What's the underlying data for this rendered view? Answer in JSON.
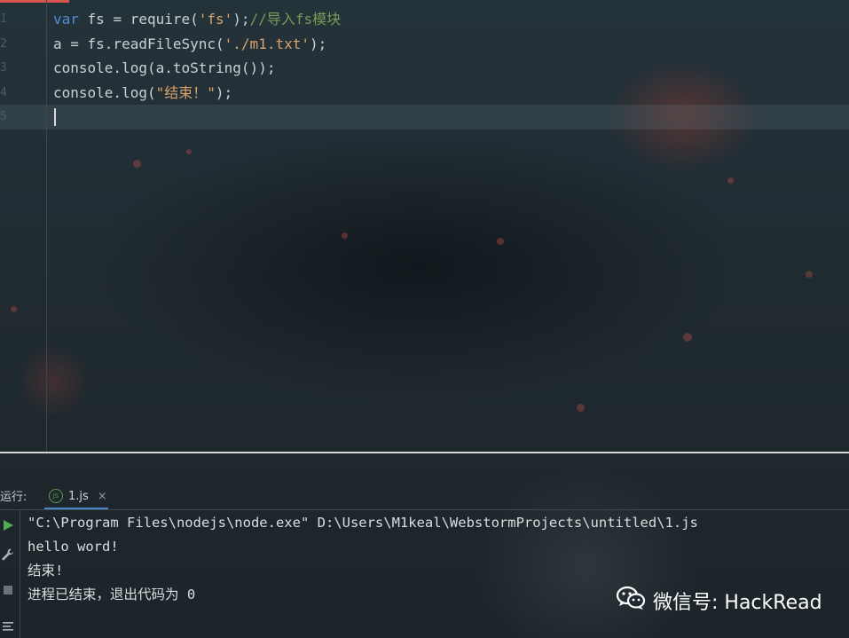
{
  "editor": {
    "line_numbers": [
      "1",
      "2",
      "3",
      "4",
      "5"
    ],
    "lines": [
      {
        "kw": "var",
        "plain": " fs = require(",
        "str": "'fs'",
        "tail": ");",
        "comment": "//导入fs模块"
      },
      {
        "plain": "a = fs.readFileSync(",
        "str": "'./m1.txt'",
        "tail": ");"
      },
      {
        "plain": "console.log(a.toString());"
      },
      {
        "plain": "console.log(",
        "str": "\"结束！\"",
        "tail": ");"
      }
    ]
  },
  "run_panel": {
    "label": "运行:",
    "tab_name": "1.js",
    "tab_icon": "JS",
    "tab_close": "×",
    "output": [
      "\"C:\\Program Files\\nodejs\\node.exe\" D:\\Users\\M1keal\\WebstormProjects\\untitled\\1.js",
      "hello word!",
      "结束!",
      "进程已结束，退出代码为 0"
    ],
    "tools": [
      "run-icon",
      "wrench-icon",
      "stop-icon",
      "soft-wrap-icon"
    ]
  },
  "watermark": {
    "text": "微信号: HackRead"
  },
  "colors": {
    "keyword": "#4e8ed6",
    "string": "#d9a26b",
    "comment": "#7a9a55",
    "run_green": "#4caf50",
    "tab_accent": "#4a88c7"
  }
}
